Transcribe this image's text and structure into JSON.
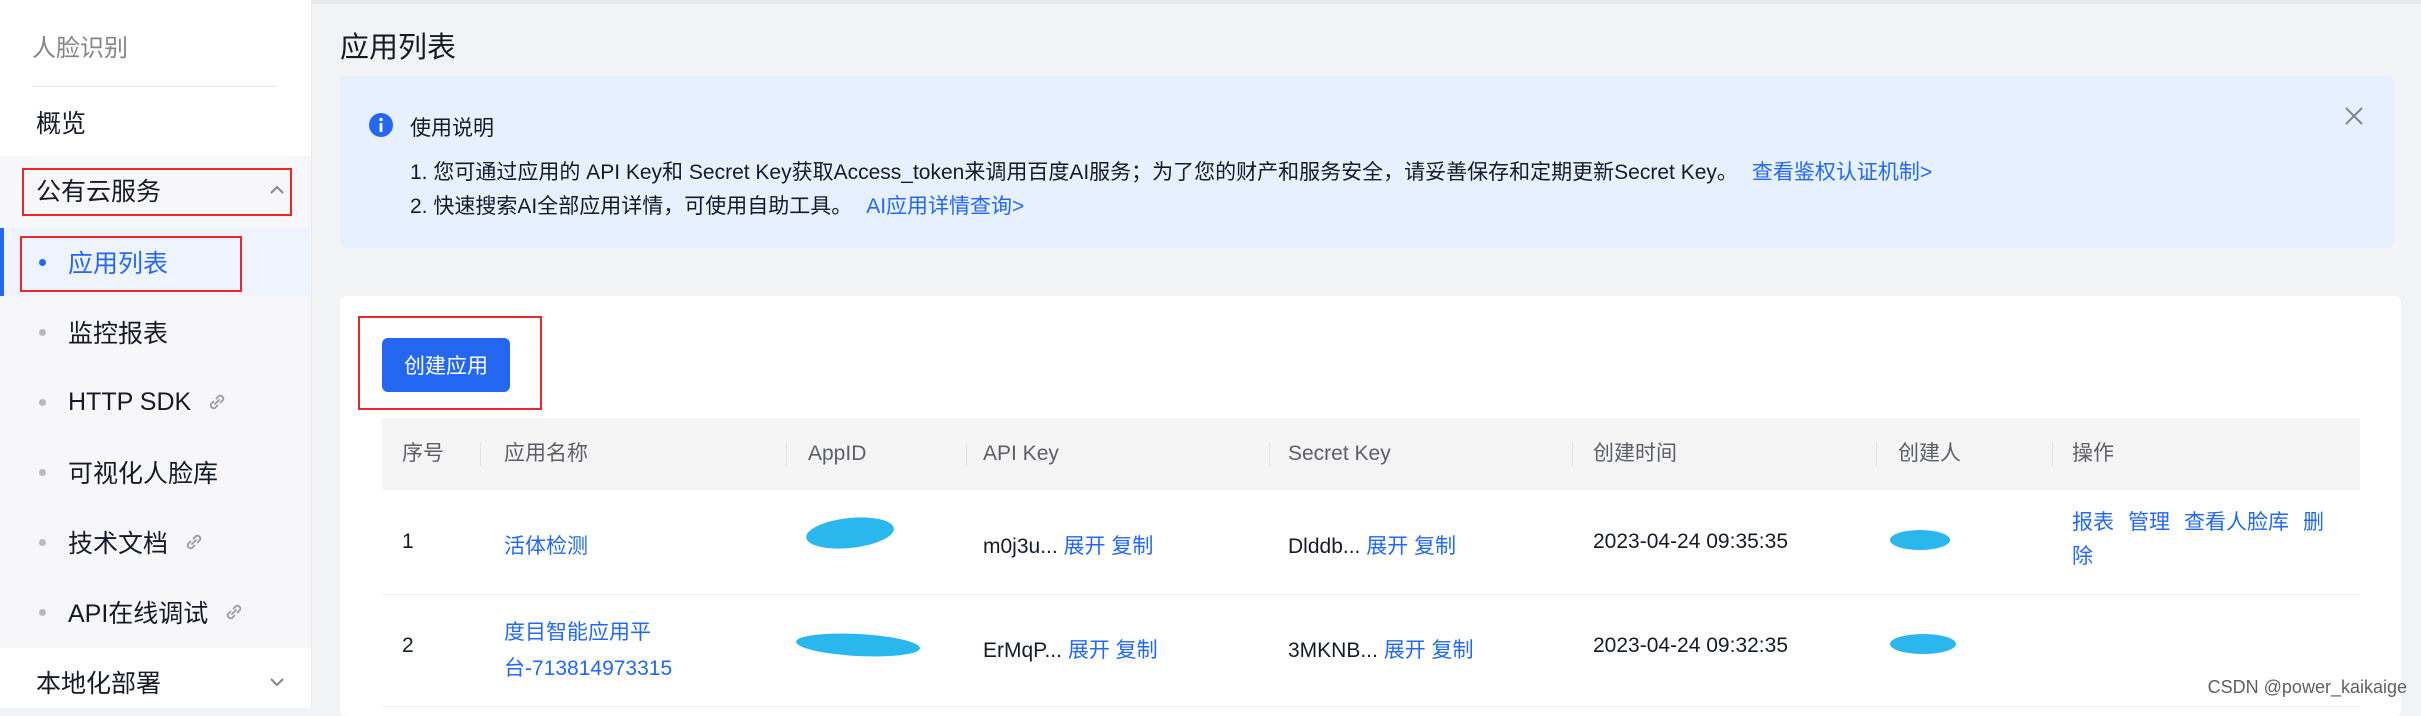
{
  "sidebar": {
    "title": "人脸识别",
    "items": [
      {
        "label": "概览"
      },
      {
        "label": "公有云服务"
      },
      {
        "label": "本地化部署"
      }
    ],
    "sub_items": [
      {
        "label": "应用列表",
        "active": true
      },
      {
        "label": "监控报表"
      },
      {
        "label": "HTTP SDK",
        "external": true
      },
      {
        "label": "可视化人脸库"
      },
      {
        "label": "技术文档",
        "external": true
      },
      {
        "label": "API在线调试",
        "external": true
      }
    ]
  },
  "page": {
    "title": "应用列表"
  },
  "notice": {
    "title": "使用说明",
    "line1": "1. 您可通过应用的 API Key和 Secret Key获取Access_token来调用百度AI服务；为了您的财产和服务安全，请妥善保存和定期更新Secret Key。",
    "line1_link": "查看鉴权认证机制>",
    "line2": "2. 快速搜索AI全部应用详情，可使用自助工具。",
    "line2_link": "AI应用详情查询>"
  },
  "create_button": "创建应用",
  "table": {
    "columns": [
      "序号",
      "应用名称",
      "AppID",
      "API Key",
      "Secret Key",
      "创建时间",
      "创建人",
      "操作"
    ],
    "expand_label": "展开",
    "copy_label": "复制",
    "rows": [
      {
        "index": "1",
        "name": "活体检测",
        "appid": "",
        "api_key": "m0j3u...",
        "secret_key": "Dlddb...",
        "created": "2023-04-24 09:35:35",
        "creator": "",
        "ops": [
          "报表",
          "管理",
          "查看人脸库",
          "删除"
        ]
      },
      {
        "index": "2",
        "name_line1": "度目智能应用平",
        "name_line2": "台-713814973315",
        "appid": "",
        "api_key": "ErMqP...",
        "secret_key": "3MKNB...",
        "created": "2023-04-24 09:32:35",
        "creator": ""
      }
    ]
  },
  "watermark": "CSDN @power_kaikaige",
  "colors": {
    "primary": "#2468f2",
    "highlight_box": "#e8262c",
    "redaction": "#2ab7ee"
  }
}
